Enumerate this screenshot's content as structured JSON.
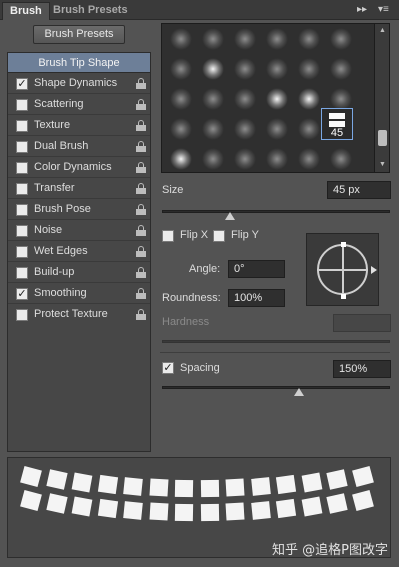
{
  "tabs": {
    "active": "Brush",
    "inactive": "Brush Presets"
  },
  "toolbar_icons": [
    "double-chevron-right-icon",
    "panel-menu-icon"
  ],
  "presets_button": "Brush Presets",
  "options": {
    "header": "Brush Tip Shape",
    "items": [
      {
        "label": "Shape Dynamics",
        "checked": true
      },
      {
        "label": "Scattering",
        "checked": false
      },
      {
        "label": "Texture",
        "checked": false
      },
      {
        "label": "Dual Brush",
        "checked": false
      },
      {
        "label": "Color Dynamics",
        "checked": false
      },
      {
        "label": "Transfer",
        "checked": false
      },
      {
        "label": "Brush Pose",
        "checked": false
      },
      {
        "label": "Noise",
        "checked": false
      },
      {
        "label": "Wet Edges",
        "checked": false
      },
      {
        "label": "Build-up",
        "checked": false
      },
      {
        "label": "Smoothing",
        "checked": true
      },
      {
        "label": "Protect Texture",
        "checked": false
      }
    ]
  },
  "tip": {
    "selected_size": "45"
  },
  "size": {
    "label": "Size",
    "value": "45 px",
    "slider_fraction": 0.3
  },
  "flip_x": {
    "label": "Flip X",
    "checked": false
  },
  "flip_y": {
    "label": "Flip Y",
    "checked": false
  },
  "angle": {
    "label": "Angle:",
    "value": "0°"
  },
  "roundness": {
    "label": "Roundness:",
    "value": "100%"
  },
  "hardness": {
    "label": "Hardness",
    "value": ""
  },
  "spacing": {
    "label": "Spacing",
    "checked": true,
    "value": "150%",
    "slider_fraction": 0.6
  },
  "watermark": "知乎 @追格P图改字",
  "colors": {
    "panel": "#535353",
    "header_highlight": "#6d7f98",
    "selection_border": "#7aa7e3"
  }
}
